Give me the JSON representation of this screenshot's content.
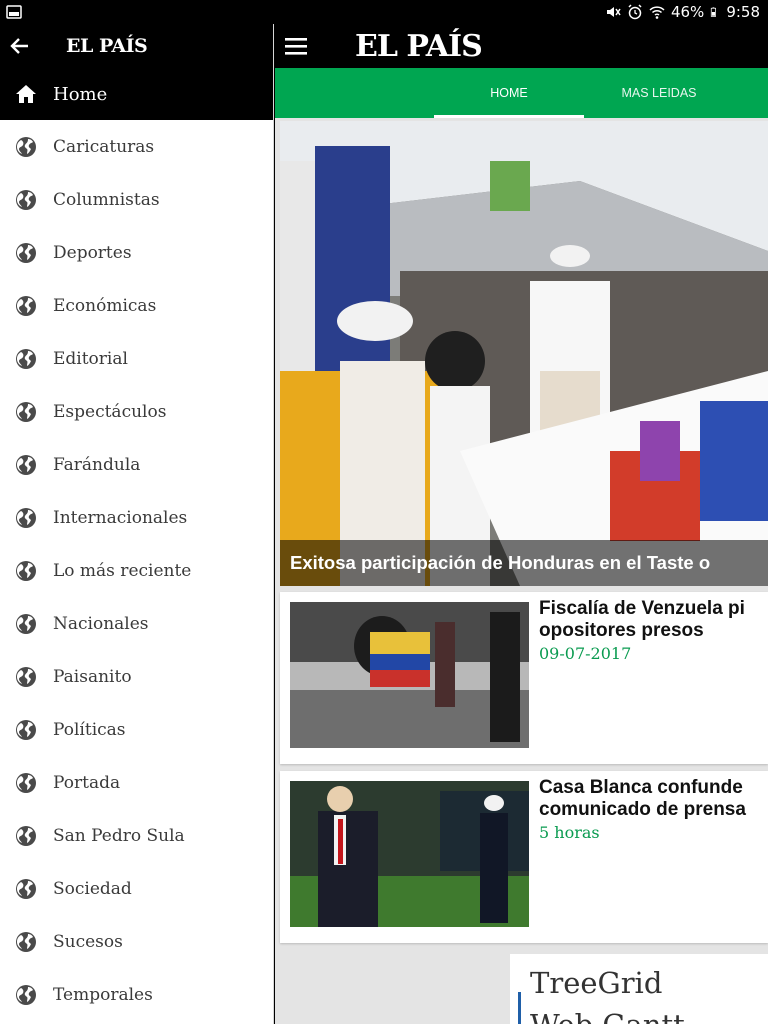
{
  "status_bar": {
    "battery": "46%",
    "time": "9:58",
    "icons": [
      "gallery-icon",
      "mute-icon",
      "alarm-icon",
      "wifi-icon",
      "battery-icon"
    ]
  },
  "drawer": {
    "logo": "EL PAÍS",
    "logo_mark": "",
    "home_label": "Home",
    "items": [
      {
        "label": "Caricaturas"
      },
      {
        "label": "Columnistas"
      },
      {
        "label": "Deportes"
      },
      {
        "label": "Económicas"
      },
      {
        "label": "Editorial"
      },
      {
        "label": "Espectáculos"
      },
      {
        "label": "Farándula"
      },
      {
        "label": "Internacionales"
      },
      {
        "label": "Lo más reciente"
      },
      {
        "label": "Nacionales"
      },
      {
        "label": "Paisanito"
      },
      {
        "label": "Políticas"
      },
      {
        "label": "Portada"
      },
      {
        "label": "San Pedro Sula"
      },
      {
        "label": "Sociedad"
      },
      {
        "label": "Sucesos"
      },
      {
        "label": "Temporales"
      }
    ]
  },
  "appbar": {
    "logo": "EL PAÍS"
  },
  "tabs": [
    {
      "label": "HOME"
    },
    {
      "label": "MAS LEIDAS"
    }
  ],
  "hero": {
    "caption": "Exitosa participación de Honduras en el Taste o"
  },
  "articles": [
    {
      "title": "Fiscalía de Venzuela pi opositores presos",
      "meta": "09-07-2017"
    },
    {
      "title": "Casa Blanca confunde comunicado de prensa",
      "meta": "5 horas"
    }
  ],
  "ad": {
    "line1": "TreeGrid",
    "line2": "Web Gantt"
  },
  "colors": {
    "accent": "#00a651",
    "date": "#0a9b50",
    "bar": "#000000"
  }
}
